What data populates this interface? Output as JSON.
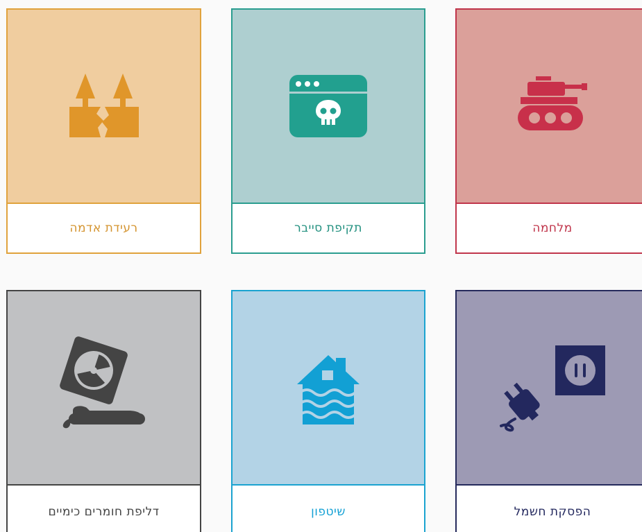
{
  "cards": [
    {
      "label": "רעידת אדמה",
      "icon": "earthquake-icon",
      "border_color": "#e0a23c",
      "bg_color": "#f0cd9f",
      "icon_color": "#e0962a"
    },
    {
      "label": "תקיפת סייבר",
      "icon": "cyber-attack-icon",
      "border_color": "#2a9d8f",
      "bg_color": "#aecfd0",
      "icon_color": "#22a08f"
    },
    {
      "label": "מלחמה",
      "icon": "tank-icon",
      "border_color": "#c0354b",
      "bg_color": "#dba09a",
      "icon_color": "#c8304a"
    },
    {
      "label": "דליפת חומרים כימיים",
      "icon": "chemical-leak-icon",
      "border_color": "#444444",
      "bg_color": "#c0c1c3",
      "icon_color": "#444444"
    },
    {
      "label": "שיטפון",
      "icon": "flood-icon",
      "border_color": "#1aa3d0",
      "bg_color": "#b3d3e6",
      "icon_color": "#12a0d4"
    },
    {
      "label": "הפסקת חשמל",
      "icon": "power-outage-icon",
      "border_color": "#252a5c",
      "bg_color": "#9d9ab4",
      "icon_color": "#23285e"
    }
  ]
}
